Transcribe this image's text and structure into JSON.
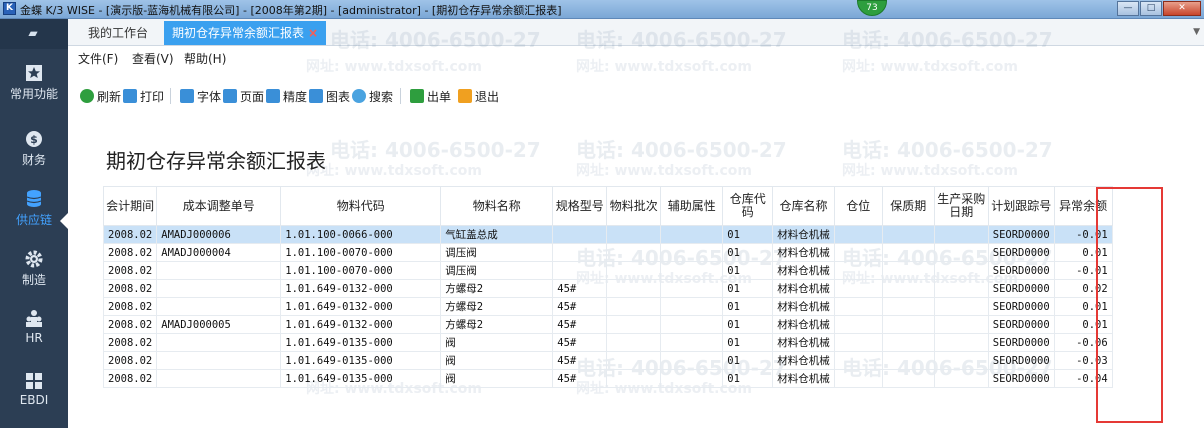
{
  "window": {
    "title": "金蝶 K/3 WISE - [演示版-蓝海机械有限公司] - [2008年第2期] - [administrator] - [期初仓存异常余额汇报表]",
    "badge": "73",
    "app_icon": "K"
  },
  "sidebar": {
    "collapse_icon": "collapse-icon",
    "items": [
      {
        "label": "常用功能",
        "icon": "star-icon"
      },
      {
        "label": "财务",
        "icon": "finance-icon"
      },
      {
        "label": "供应链",
        "icon": "database-icon",
        "active": true
      },
      {
        "label": "制造",
        "icon": "gear-icon"
      },
      {
        "label": "HR",
        "icon": "people-icon"
      },
      {
        "label": "EBDI",
        "icon": "grid-icon"
      }
    ]
  },
  "tabs": [
    {
      "label": "我的工作台"
    },
    {
      "label": "期初仓存异常余额汇报表",
      "close": "×"
    }
  ],
  "menu": [
    "文件(F)",
    "查看(V)",
    "帮助(H)"
  ],
  "toolbar": [
    {
      "label": "刷新",
      "icon": "refresh-icon"
    },
    {
      "label": "打印",
      "icon": "print-icon"
    },
    {
      "label": "字体",
      "icon": "font-icon"
    },
    {
      "label": "页面",
      "icon": "page-icon"
    },
    {
      "label": "精度",
      "icon": "precision-icon"
    },
    {
      "label": "图表",
      "icon": "chart-icon"
    },
    {
      "label": "搜索",
      "icon": "search-icon"
    },
    {
      "label": "出单",
      "icon": "output-icon"
    },
    {
      "label": "退出",
      "icon": "exit-icon"
    }
  ],
  "watermark": {
    "phone": "电话: 4006-6500-27",
    "site": "网址: www.tdxsoft.com"
  },
  "report": {
    "title": "期初仓存异常余额汇报表",
    "columns": [
      "会计期间",
      "成本调整单号",
      "物料代码",
      "物料名称",
      "规格型号",
      "物料批次",
      "辅助属性",
      "仓库代码",
      "仓库名称",
      "仓位",
      "保质期",
      "生产采购日期",
      "计划跟踪号",
      "异常余额"
    ],
    "rows": [
      [
        "2008.02",
        "AMADJ000006",
        "1.01.100-0066-000",
        "气缸盖总成",
        "",
        "",
        "",
        "01",
        "材料仓机械",
        "",
        "",
        "",
        "SEORD0000",
        "-0.01"
      ],
      [
        "2008.02",
        "AMADJ000004",
        "1.01.100-0070-000",
        "调压阀",
        "",
        "",
        "",
        "01",
        "材料仓机械",
        "",
        "",
        "",
        "SEORD0000",
        "0.01"
      ],
      [
        "2008.02",
        "",
        "1.01.100-0070-000",
        "调压阀",
        "",
        "",
        "",
        "01",
        "材料仓机械",
        "",
        "",
        "",
        "SEORD0000",
        "-0.01"
      ],
      [
        "2008.02",
        "",
        "1.01.649-0132-000",
        "方螺母2",
        "45#",
        "",
        "",
        "01",
        "材料仓机械",
        "",
        "",
        "",
        "SEORD0000",
        "0.02"
      ],
      [
        "2008.02",
        "",
        "1.01.649-0132-000",
        "方螺母2",
        "45#",
        "",
        "",
        "01",
        "材料仓机械",
        "",
        "",
        "",
        "SEORD0000",
        "0.01"
      ],
      [
        "2008.02",
        "AMADJ000005",
        "1.01.649-0132-000",
        "方螺母2",
        "45#",
        "",
        "",
        "01",
        "材料仓机械",
        "",
        "",
        "",
        "SEORD0000",
        "0.01"
      ],
      [
        "2008.02",
        "",
        "1.01.649-0135-000",
        "阀",
        "45#",
        "",
        "",
        "01",
        "材料仓机械",
        "",
        "",
        "",
        "SEORD0000",
        "-0.06"
      ],
      [
        "2008.02",
        "",
        "1.01.649-0135-000",
        "阀",
        "45#",
        "",
        "",
        "01",
        "材料仓机械",
        "",
        "",
        "",
        "SEORD0000",
        "-0.03"
      ],
      [
        "2008.02",
        "",
        "1.01.649-0135-000",
        "阀",
        "45#",
        "",
        "",
        "01",
        "材料仓机械",
        "",
        "",
        "",
        "SEORD0000",
        "-0.04"
      ]
    ],
    "selected_row": 0
  },
  "colors": {
    "sidebar": "#2c3e54",
    "accent": "#3aa0ef",
    "highlight_box": "#e53935",
    "selected_row": "#c9e1f7"
  }
}
